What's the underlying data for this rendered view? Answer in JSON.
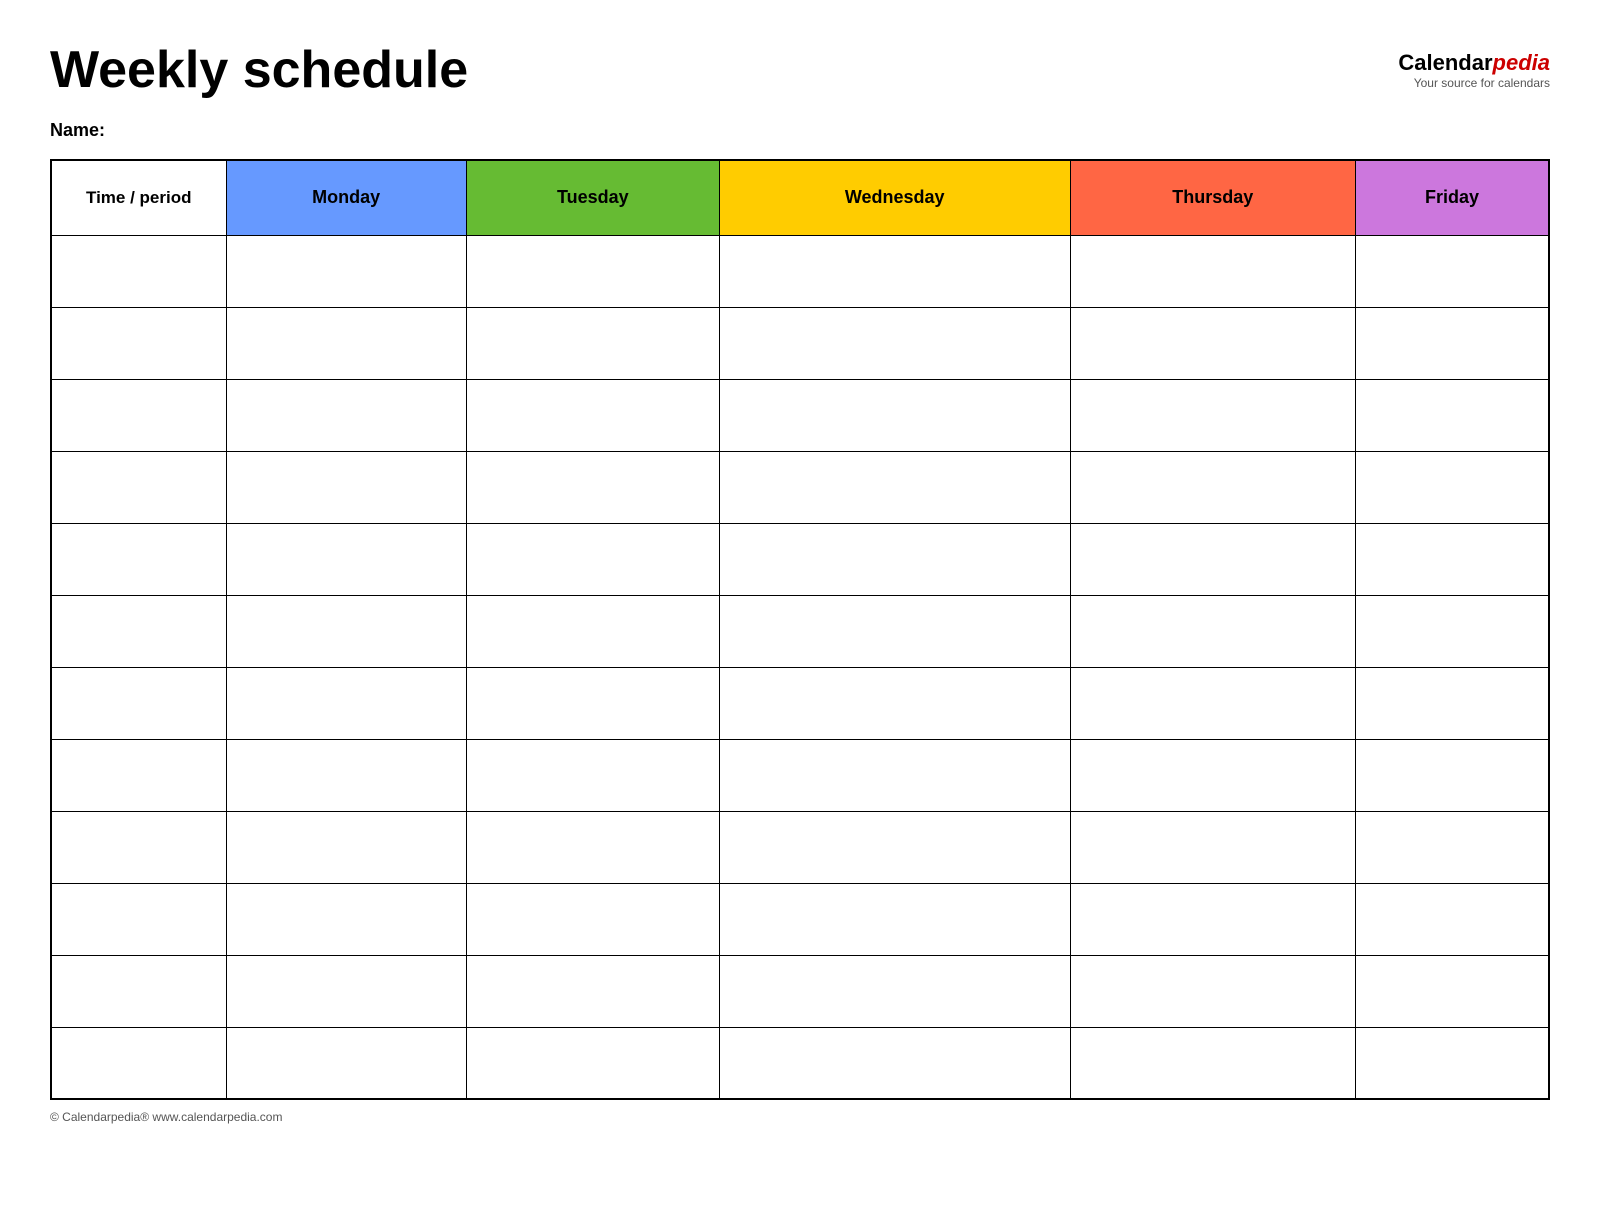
{
  "header": {
    "title": "Weekly schedule",
    "logo": {
      "calendar_part": "Calendar",
      "pedia_part": "pedia",
      "tagline": "Your source for calendars"
    }
  },
  "name_label": "Name:",
  "table": {
    "headers": [
      {
        "label": "Time / period",
        "class": "time-header"
      },
      {
        "label": "Monday",
        "class": "monday"
      },
      {
        "label": "Tuesday",
        "class": "tuesday"
      },
      {
        "label": "Wednesday",
        "class": "wednesday"
      },
      {
        "label": "Thursday",
        "class": "thursday"
      },
      {
        "label": "Friday",
        "class": "friday"
      }
    ],
    "row_count": 12
  },
  "footer": {
    "text": "© Calendarpedia®  www.calendarpedia.com"
  }
}
